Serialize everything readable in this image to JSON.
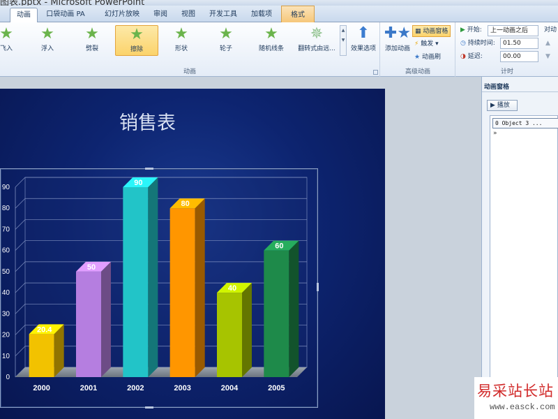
{
  "window": {
    "title": "图表.pptx - Microsoft PowerPoint"
  },
  "tabs": [
    {
      "label": "动画",
      "active": true
    },
    {
      "label": "口袋动画 PA"
    },
    {
      "label": "幻灯片放映"
    },
    {
      "label": "审阅"
    },
    {
      "label": "视图"
    },
    {
      "label": "开发工具"
    },
    {
      "label": "加载项"
    },
    {
      "label": "格式",
      "contextual": true
    }
  ],
  "ribbon": {
    "animation_group": {
      "label": "动画",
      "items": [
        {
          "label": "飞入",
          "icon": "star-icon"
        },
        {
          "label": "浮入",
          "icon": "star-icon"
        },
        {
          "label": "劈裂",
          "icon": "star-icon"
        },
        {
          "label": "擦除",
          "icon": "star-icon",
          "selected": true
        },
        {
          "label": "形状",
          "icon": "star-icon"
        },
        {
          "label": "轮子",
          "icon": "star-icon"
        },
        {
          "label": "随机线条",
          "icon": "star-icon"
        },
        {
          "label": "翻转式由远...",
          "icon": "star-icon"
        }
      ],
      "effect_options": "效果选项"
    },
    "advanced_group": {
      "label": "高级动画",
      "add_animation": "添加动画",
      "animation_pane": "动画窗格",
      "trigger": "触发",
      "animation_painter": "动画刷"
    },
    "timing_group": {
      "label": "计时",
      "start_label": "开始:",
      "start_value": "上一动画之后",
      "duration_label": "持续时间:",
      "duration_value": "01.50",
      "delay_label": "延迟:",
      "delay_value": "00.00",
      "reorder_label": "对动"
    }
  },
  "slide": {
    "title": "销售表"
  },
  "chart_data": {
    "type": "bar",
    "categories": [
      "2000",
      "2001",
      "2002",
      "2003",
      "2004",
      "2005"
    ],
    "values": [
      20.4,
      50,
      90,
      80,
      40,
      60
    ],
    "data_labels": [
      "20.4",
      "50",
      "90",
      "80",
      "40",
      "60"
    ],
    "colors": [
      "#f2c200",
      "#b57ee0",
      "#22c4c8",
      "#ff9600",
      "#a7c400",
      "#1e8a4a"
    ],
    "ylim": [
      0,
      90
    ],
    "yticks": [
      0,
      10,
      20,
      30,
      40,
      50,
      60,
      70,
      80,
      90
    ],
    "ytick_labels": [
      "0",
      "10",
      "20",
      "30",
      "40",
      "50",
      "60",
      "70",
      "80",
      "90"
    ],
    "grid": true,
    "style": "3d-column"
  },
  "animation_pane": {
    "title": "动画窗格",
    "play_label": "播放",
    "items": [
      {
        "label": "0 Object 3 ..."
      }
    ]
  },
  "watermark": {
    "text": "易采站长站",
    "url": "www.easck.com"
  }
}
